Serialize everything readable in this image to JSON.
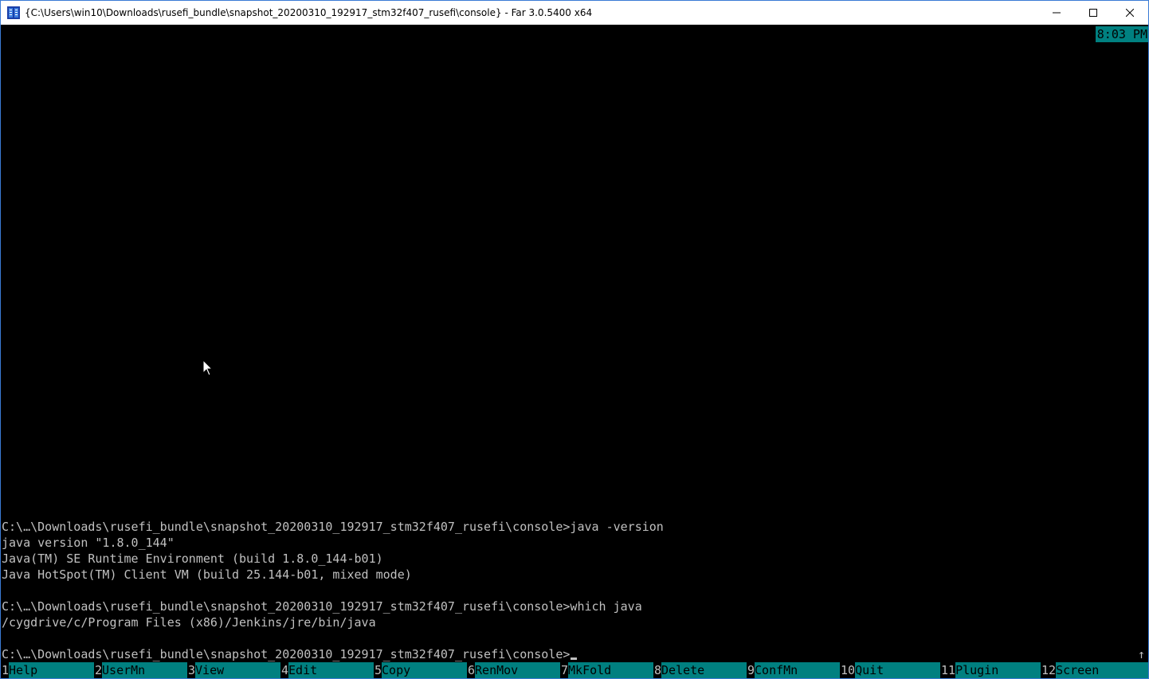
{
  "window": {
    "title": "{C:\\Users\\win10\\Downloads\\rusefi_bundle\\snapshot_20200310_192917_stm32f407_rusefi\\console} - Far 3.0.5400 x64",
    "controls": [
      "minimize-icon",
      "maximize-icon",
      "close-icon"
    ]
  },
  "clock": "8:03 PM",
  "console_lines": [
    "C:\\…\\Downloads\\rusefi_bundle\\snapshot_20200310_192917_stm32f407_rusefi\\console>java -version",
    "java version \"1.8.0_144\"",
    "Java(TM) SE Runtime Environment (build 1.8.0_144-b01)",
    "Java HotSpot(TM) Client VM (build 25.144-b01, mixed mode)",
    "",
    "C:\\…\\Downloads\\rusefi_bundle\\snapshot_20200310_192917_stm32f407_rusefi\\console>which java",
    "/cygdrive/c/Program Files (x86)/Jenkins/jre/bin/java",
    "",
    "C:\\…\\Downloads\\rusefi_bundle\\snapshot_20200310_192917_stm32f407_rusefi\\console>"
  ],
  "scroll_indicator": "↑",
  "keybar": [
    {
      "num": "1",
      "label": "Help"
    },
    {
      "num": "2",
      "label": "UserMn"
    },
    {
      "num": "3",
      "label": "View"
    },
    {
      "num": "4",
      "label": "Edit"
    },
    {
      "num": "5",
      "label": "Copy"
    },
    {
      "num": "6",
      "label": "RenMov"
    },
    {
      "num": "7",
      "label": "MkFold"
    },
    {
      "num": "8",
      "label": "Delete"
    },
    {
      "num": "9",
      "label": "ConfMn"
    },
    {
      "num": "10",
      "label": "Quit"
    },
    {
      "num": "11",
      "label": "Plugin"
    },
    {
      "num": "12",
      "label": "Screen"
    }
  ],
  "colors": {
    "background": "#000000",
    "text": "#c0c0c0",
    "keybar_label_bg": "#008080",
    "clock_bg": "#008080"
  }
}
